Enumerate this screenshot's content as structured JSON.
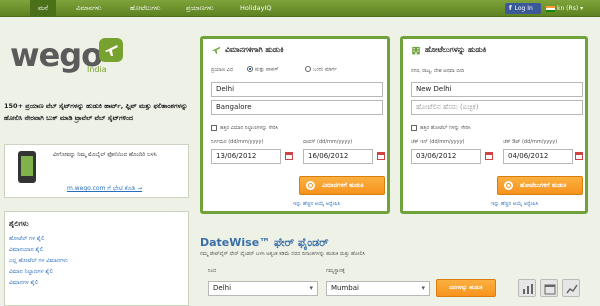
{
  "nav": {
    "tabs": [
      "ಮನೆ",
      "ವಿಮಾನಗಳು",
      "ಹೋಟೆಲುಗಳು",
      "ಪ್ರಯಾಣಗಳು",
      "HolidayIQ"
    ],
    "fb_login": "Log In",
    "lang": "kn (Rs)"
  },
  "logo": {
    "text": "wego",
    "sub": "India"
  },
  "tagline": "150+ ಪ್ರಯಾಣ ವೆಬ್ ಸೈಟ್‌ಗಳನ್ನು ಹುಡುಕಿ ಹಾರ್ಟ್, ಫ್ಲಿಪ್ ಮತ್ತು ಫಲಿತಾಂಶಗಳನ್ನು ಹೋಲಿಸಿ ನೇರವಾಗಿ ಬುಕ್ ಮಾಡಿ ಟ್ರಾವೆಲ್ ವೆಬ್ ಸೈಟ್‌ಗಳಿಂದ",
  "mobile": {
    "text": "ವೀಗೋವನ್ನು ನಿಮ್ಮ ಮೊಬೈಲ್ ಫೋನಿನಿಂದ ಹೊಂದಿರಿ ಬಳಸಿ",
    "link": "m.wego.com ಗೆ ಭೇಟಿ ಕೊಡಿ →"
  },
  "links": {
    "title": "ಶೈಲಿಗಳು",
    "items": [
      "ಹೋಟೆಲ್ ಗಳ ಶೈಲಿ",
      "ವಿಮಾನಯಾನ ಶೈಲಿ",
      "ಎಲ್ಲ ಹೋಟೆಲ್ ಗಳ ವಿಮಾನಗಳು",
      "ವಿಮಾನ ನಿಲ್ದಾಣಗಳ ಶೈಲಿ",
      "ವಿಮಾನಗಳ ಶೈಲಿ"
    ]
  },
  "flights": {
    "title": "ವಿಮಾನಗಳಿಗಾಗಿ ಹುಡುಕಿ",
    "trip_label": "ಪ್ರಯಾಣ ವಿಧ",
    "round_trip": "ಮತ್ತು ವಾಪಸ್",
    "one_way": "ಒಂದು ಮಾರ್ಗ",
    "from_value": "Delhi",
    "to_value": "Bangalore",
    "nearby_label": "ಹತ್ತಿರ ವಿಮಾನ ನಿಲ್ದಾಣಗಳನ್ನು ಸೇರಿಸಿ",
    "depart_label": "ನಿರ್ಗಮನ (dd/mm/yyyy)",
    "return_label": "ವಾಪಸ್ (dd/mm/yyyy)",
    "depart_value": "13/06/2012",
    "return_value": "16/06/2012",
    "search_label": "ವಿಮಾನಗಳಿಗೆ ಹುಡುಕಿ",
    "more_label": "ಇನ್ನು ಹೆಚ್ಚಿನ ಆಯ್ಕೆ ಅನ್ವೇಷಿಸಿ"
  },
  "hotels": {
    "title": "ಹೋಟೆಲುಗಳನ್ನು ಹುಡುಕಿ",
    "where_label": "ನಗರ, ರಾಜ್ಯ, ದೇಶ ಅಥವಾ ಬೀದಿ",
    "city_value": "New Delhi",
    "hotel_placeholder": "ಹೋಟೆಲಿನ ಹೆಸರು (ಐಚ್ಛಿಕ)",
    "nearby_label": "ಹತ್ತಿರ ಹೋಟೆಲ್ ಗಳನ್ನು ಸೇರಿಸಿ",
    "checkin_label": "ಚೆಕ್ ಇನ್ (dd/mm/yyyy)",
    "checkout_label": "ಚೆಕ್ ಔಟ್ (dd/mm/yyyy)",
    "checkin_value": "03/06/2012",
    "checkout_value": "04/06/2012",
    "search_label": "ಹೋಟೆಲುಗಳಿಗೆ ಹುಡುಕಿ",
    "more_label": "ಇನ್ನು ಹೆಚ್ಚಿನ ಆಯ್ಕೆ ಅನ್ವೇಷಿಸಿ"
  },
  "datewise": {
    "title": "DateWise™ ಫೇರ್ ಫೈಂಡರ್",
    "desc": "ನಮ್ಮ ಡೇಟ್‌ವೈಸ್ ಫೇರ್ ಫೈಂಡರ್ ಬಳಸಿ ಅತ್ಯಂತ ಕಡಿಮೆ ದರದ ದಿನಾಂಕಗಳನ್ನು ಹುಡುಕಿ ಮತ್ತು ಹೋಲಿಸಿ",
    "from_label": "ನಿಂದ",
    "to_label": "ಗಮ್ಯಸ್ಥಾನಕ್ಕೆ",
    "from_value": "Delhi",
    "to_value": "Mumbai",
    "btn_label": "ದರಗಳನ್ನು ಹುಡುಕಿ"
  },
  "colors": {
    "brand_green": "#6fa23a",
    "search_orange": "#f7931e",
    "link_blue": "#2a6ebb"
  }
}
